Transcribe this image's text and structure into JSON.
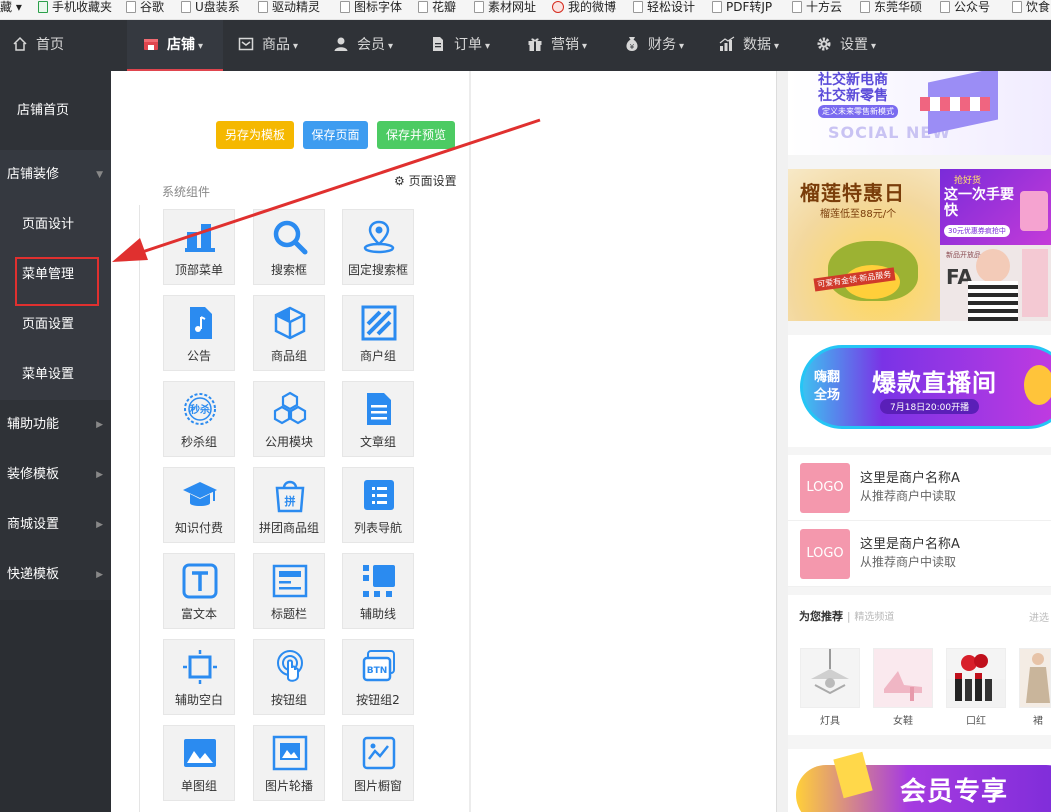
{
  "bookmarks": [
    "藏",
    "手机收藏夹",
    "谷歌",
    "U盘装系",
    "驱动精灵",
    "图标字体",
    "花瓣",
    "素材网址",
    "我的微博",
    "轻松设计",
    "PDF转JP",
    "十方云",
    "东莞华硕",
    "公众号",
    "饮食"
  ],
  "topnav": {
    "home": "首页",
    "items": [
      "店铺",
      "商品",
      "会员",
      "订单",
      "营销",
      "财务",
      "数据",
      "设置"
    ]
  },
  "sidebar": {
    "items": [
      "店铺首页",
      "店铺装修",
      "页面设计",
      "菜单管理",
      "页面设置",
      "菜单设置",
      "辅助功能",
      "装修模板",
      "商城设置",
      "快递模板"
    ]
  },
  "editor": {
    "save_template": "另存为模板",
    "save_page": "保存页面",
    "save_preview": "保存并预览",
    "section_title": "系统组件",
    "page_settings": "页面设置"
  },
  "components": [
    "顶部菜单",
    "搜索框",
    "固定搜索框",
    "公告",
    "商品组",
    "商户组",
    "秒杀组",
    "公用模块",
    "文章组",
    "知识付费",
    "拼团商品组",
    "列表导航",
    "富文本",
    "标题栏",
    "辅助线",
    "辅助空白",
    "按钮组",
    "按钮组2",
    "单图组",
    "图片轮播",
    "图片橱窗"
  ],
  "preview": {
    "banner1_line1": "社交新电商",
    "banner1_line2": "社交新零售",
    "banner1_tag": "定义未来零售新模式",
    "banner1_en": "SOCIAL NEW",
    "durian_title": "榴莲特惠日",
    "durian_price": "榴莲低至88元/个",
    "durian_tag": "可爱有金领·新品服务",
    "flash_top": "抢好货",
    "flash_main": "这一次手要快",
    "flash_sub": "30元优惠券疯抢中",
    "fashion_text": "FA",
    "fashion_tag": "新品开放品",
    "live_left1": "嗨翻",
    "live_left2": "全场",
    "live_main": "爆款直播间",
    "live_date": "7月18日20:00开播",
    "shops": [
      {
        "logo": "LOGO",
        "name": "这里是商户名称A",
        "sub": "从推荐商户中读取"
      },
      {
        "logo": "LOGO",
        "name": "这里是商户名称A",
        "sub": "从推荐商户中读取"
      }
    ],
    "recommend": "为您推荐",
    "recommend_sub": "精选频道",
    "more": "进选",
    "products": [
      "灯具",
      "女鞋",
      "口红",
      "裙"
    ],
    "member_banner": "会员专享"
  },
  "colors": {
    "nav_bg": "#2f3237",
    "accent_red": "#e0454e",
    "btn_yellow": "#f5b800",
    "btn_blue": "#3d9cf0",
    "btn_green": "#4ccb63",
    "icon_blue": "#2b8bf0"
  }
}
